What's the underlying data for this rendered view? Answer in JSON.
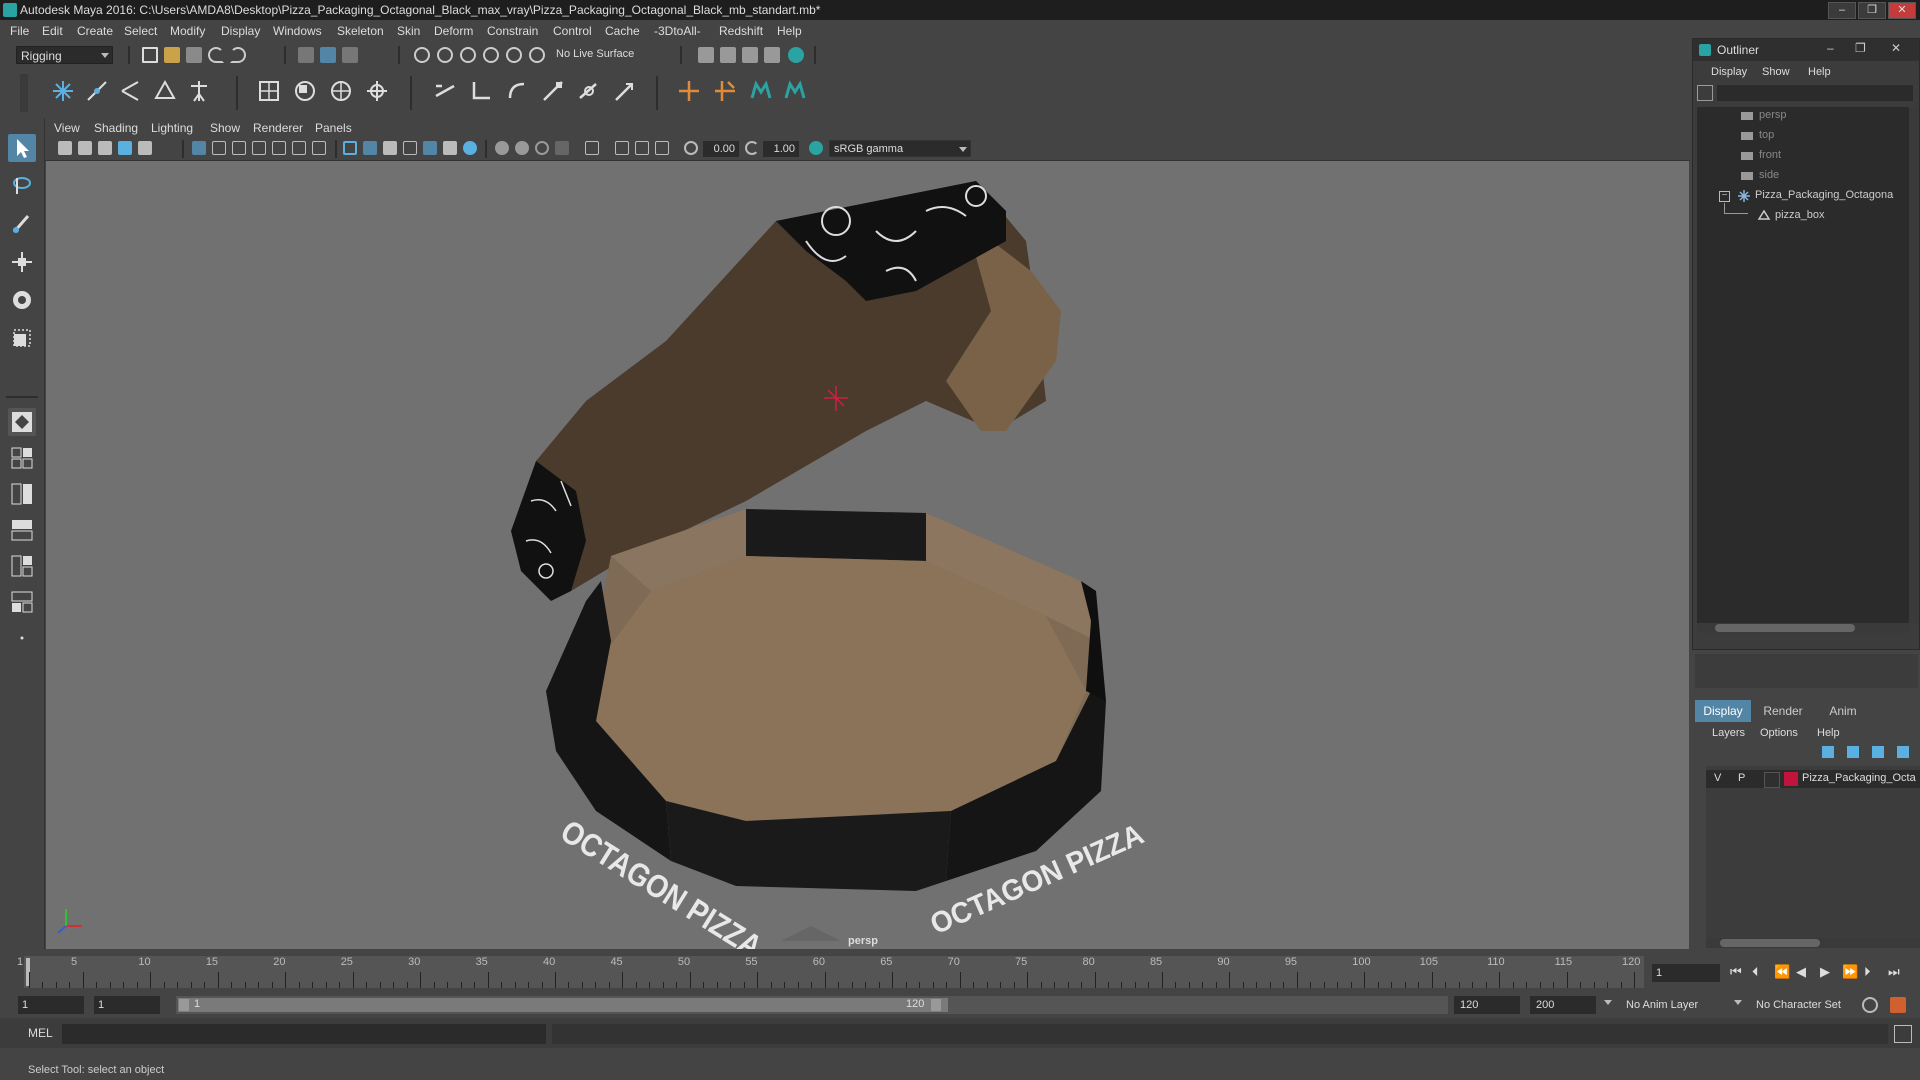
{
  "titlebar": {
    "title": "Autodesk Maya 2016: C:\\Users\\AMDA8\\Desktop\\Pizza_Packaging_Octagonal_Black_max_vray\\Pizza_Packaging_Octagonal_Black_mb_standart.mb*",
    "minimize": "–",
    "restore": "❐",
    "close": "✕"
  },
  "menus": [
    "File",
    "Edit",
    "Create",
    "Select",
    "Modify",
    "Display",
    "Windows",
    "Skeleton",
    "Skin",
    "Deform",
    "Constrain",
    "Control",
    "Cache",
    "-3DtoAll-",
    "Redshift",
    "Help"
  ],
  "status_line": {
    "mode": "Rigging",
    "live_surface": "No Live Surface"
  },
  "panel_menus": [
    "View",
    "Shading",
    "Lighting",
    "Show",
    "Renderer",
    "Panels"
  ],
  "panel_toolbar": {
    "exposure": "0.00",
    "gamma": "1.00",
    "color_space": "sRGB gamma"
  },
  "viewport": {
    "camera_label": "persp",
    "box_text_left": "OCTAGON PIZZA",
    "box_text_right": "OCTAGON PIZZA"
  },
  "outliner": {
    "title": "Outliner",
    "menus": [
      "Display",
      "Show",
      "Help"
    ],
    "items": [
      {
        "label": "persp"
      },
      {
        "label": "top"
      },
      {
        "label": "front"
      },
      {
        "label": "side"
      },
      {
        "label": "Pizza_Packaging_Octagona"
      },
      {
        "label": "pizza_box"
      }
    ]
  },
  "layer_editor": {
    "tabs": [
      "Display",
      "Render",
      "Anim"
    ],
    "menus": [
      "Layers",
      "Options",
      "Help"
    ],
    "layer": {
      "v": "V",
      "p": "P",
      "name": "Pizza_Packaging_Octa",
      "color": "#c0143c"
    }
  },
  "time_slider": {
    "ticks": [
      "1",
      "5",
      "10",
      "15",
      "20",
      "25",
      "30",
      "35",
      "40",
      "45",
      "50",
      "55",
      "60",
      "65",
      "70",
      "75",
      "80",
      "85",
      "90",
      "95",
      "100",
      "105",
      "110",
      "115",
      "120"
    ],
    "current_frame": "1"
  },
  "range_slider": {
    "start": "1",
    "playback_start": "1",
    "range_start_label": "1",
    "range_end_label": "120",
    "playback_end": "120",
    "end": "200",
    "anim_layer": "No Anim Layer",
    "character_set": "No Character Set"
  },
  "command_line": {
    "lang": "MEL"
  },
  "help_line": {
    "text": "Select Tool: select an object"
  },
  "colors": {
    "accent": "#5285a6",
    "teal": "#2aa3a3",
    "layer_red": "#c0143c"
  }
}
